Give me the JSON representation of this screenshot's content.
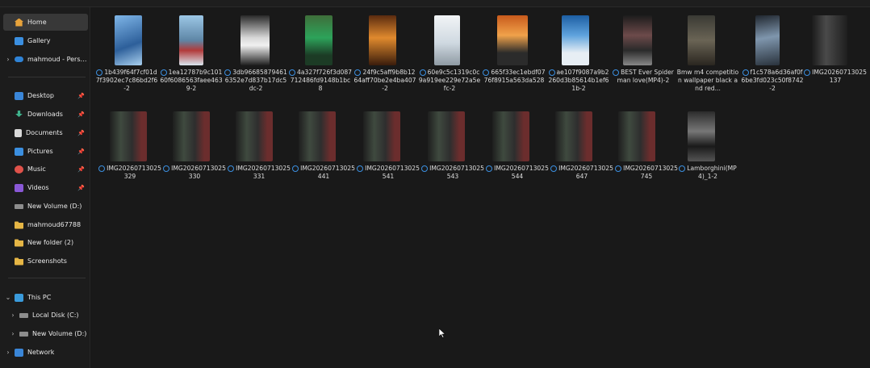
{
  "sidebar": {
    "items": [
      {
        "label": "Home",
        "icon": "home-icon"
      },
      {
        "label": "Gallery",
        "icon": "gallery-icon"
      },
      {
        "label": "mahmoud - Personal",
        "icon": "cloud-icon"
      },
      {
        "label": "Desktop",
        "icon": "desktop-folder-icon"
      },
      {
        "label": "Downloads",
        "icon": "downloads-folder-icon"
      },
      {
        "label": "Documents",
        "icon": "documents-folder-icon"
      },
      {
        "label": "Pictures",
        "icon": "pictures-folder-icon"
      },
      {
        "label": "Music",
        "icon": "music-folder-icon"
      },
      {
        "label": "Videos",
        "icon": "videos-folder-icon"
      },
      {
        "label": "New Volume (D:)",
        "icon": "drive-icon"
      },
      {
        "label": "mahmoud67788",
        "icon": "folder-icon"
      },
      {
        "label": "New folder (2)",
        "icon": "folder-icon"
      },
      {
        "label": "Screenshots",
        "icon": "folder-icon"
      },
      {
        "label": "This PC",
        "icon": "this-pc-icon"
      },
      {
        "label": "Local Disk (C:)",
        "icon": "drive-icon"
      },
      {
        "label": "New Volume (D:)",
        "icon": "drive-icon"
      },
      {
        "label": "Network",
        "icon": "network-icon"
      }
    ]
  },
  "files": {
    "row1": [
      {
        "name": "1b439f64f7cf01d7f3902ec7c86bd2f6-2"
      },
      {
        "name": "1ea12787b9c10160f6086563faee4639-2"
      },
      {
        "name": "3db966858794616352e7d837b17dc5dc-2"
      },
      {
        "name": "4a327f726f3d087712486fd9148b1bc8"
      },
      {
        "name": "24f9c5aff9b8b1264aff70be2e4ba407-2"
      },
      {
        "name": "60e9c5c1319c0c9a919ee229e72a5efc-2"
      },
      {
        "name": "665f33ec1ebdf0776f8915a563da528"
      },
      {
        "name": "ae107f9087a9b2260d3b85614b1ef61b-2"
      },
      {
        "name": "BEST Ever Spiderman love(MP4)-2"
      },
      {
        "name": "Bmw m4 competition wallpaper black and red..."
      },
      {
        "name": "f1c578a6d36af0f6be3fd023c50f8742-2"
      },
      {
        "name": "IMG20260713025137"
      }
    ],
    "row2": [
      {
        "name": "IMG20260713025329"
      },
      {
        "name": "IMG20260713025330"
      },
      {
        "name": "IMG20260713025331"
      },
      {
        "name": "IMG20260713025441"
      },
      {
        "name": "IMG20260713025541"
      },
      {
        "name": "IMG20260713025543"
      },
      {
        "name": "IMG20260713025544"
      },
      {
        "name": "IMG20260713025647"
      },
      {
        "name": "IMG20260713025745"
      },
      {
        "name": "Lamborghini(MP4)_1-2"
      }
    ]
  }
}
